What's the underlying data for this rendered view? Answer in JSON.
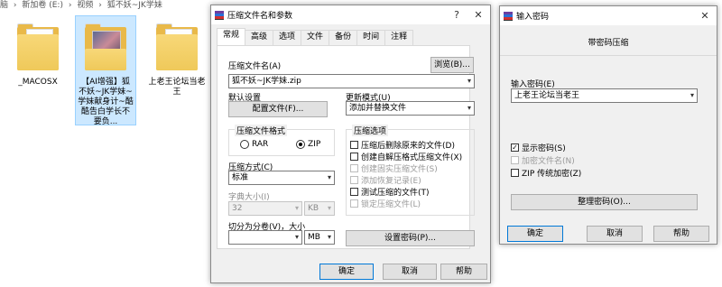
{
  "explorer": {
    "breadcrumb": [
      "脑",
      "›",
      "新加卷 (E:)",
      "›",
      "视频",
      "›",
      "狐不妖~JK学妹"
    ],
    "files": [
      {
        "label": "_MACOSX",
        "type": "folder"
      },
      {
        "label": "【AI增强】狐不妖~JK学妹~学妹献身计~酷酷告白学长不要负...",
        "type": "video-folder"
      },
      {
        "label": "上老王论坛当老王",
        "type": "folder"
      }
    ]
  },
  "archive_dialog": {
    "title": "压缩文件名和参数",
    "help_glyph": "?",
    "close_glyph": "✕",
    "tabs": [
      "常规",
      "高级",
      "选项",
      "文件",
      "备份",
      "时间",
      "注释"
    ],
    "active_tab": "常规",
    "archive_name_label": "压缩文件名(A)",
    "archive_name_value": "狐不妖~JK学妹.zip",
    "browse_label": "浏览(B)...",
    "default_settings_label": "默认设置",
    "profiles_button": "配置文件(F)...",
    "update_mode_label": "更新模式(U)",
    "update_mode_value": "添加并替换文件",
    "format_group_label": "压缩文件格式",
    "format_rar": "RAR",
    "format_zip": "ZIP",
    "format_selected": "ZIP",
    "options_group_label": "压缩选项",
    "options": [
      {
        "label": "压缩后删除原来的文件(D)",
        "checked": false,
        "disabled": false
      },
      {
        "label": "创建自解压格式压缩文件(X)",
        "checked": false,
        "disabled": false
      },
      {
        "label": "创建固实压缩文件(S)",
        "checked": false,
        "disabled": true
      },
      {
        "label": "添加恢复记录(E)",
        "checked": false,
        "disabled": true
      },
      {
        "label": "测试压缩的文件(T)",
        "checked": false,
        "disabled": false
      },
      {
        "label": "锁定压缩文件(L)",
        "checked": false,
        "disabled": true
      }
    ],
    "method_label": "压缩方式(C)",
    "method_value": "标准",
    "dict_label": "字典大小(I)",
    "dict_value": "32",
    "dict_unit": "KB",
    "split_label": "切分为分卷(V)，大小",
    "split_value": "",
    "split_unit": "MB",
    "set_password_button": "设置密码(P)...",
    "ok": "确定",
    "cancel": "取消",
    "help": "帮助"
  },
  "password_dialog": {
    "title": "输入密码",
    "header": "带密码压缩",
    "enter_label": "输入密码(E)",
    "password_value": "上老王论坛当老王",
    "show_password": {
      "label": "显示密码(S)",
      "checked": true
    },
    "encrypt_names": {
      "label": "加密文件名(N)",
      "checked": false,
      "disabled": true
    },
    "zip_legacy": {
      "label": "ZIP 传统加密(Z)",
      "checked": false
    },
    "organize_button": "整理密码(O)...",
    "ok": "确定",
    "cancel": "取消",
    "help": "帮助",
    "close_glyph": "✕"
  },
  "icons": {
    "folder": "folder-icon",
    "winrar": "winrar-icon",
    "dropdown": "chevron-down-icon"
  }
}
